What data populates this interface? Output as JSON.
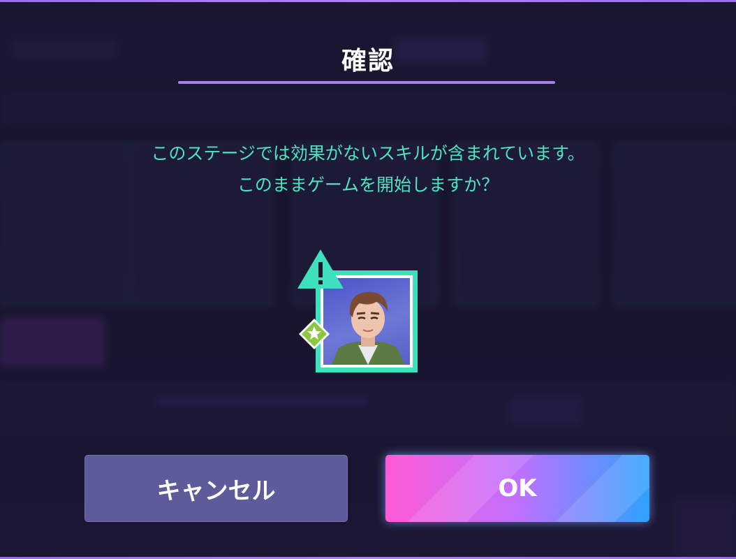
{
  "dialog": {
    "title": "確認",
    "message_line1": "このステージでは効果がないスキルが含まれています。",
    "message_line2": "このままゲームを開始しますか？"
  },
  "character_card": {
    "warning_icon": "warning-triangle-icon",
    "attribute_icon": "green-star-attribute-icon"
  },
  "buttons": {
    "cancel_label": "キャンセル",
    "ok_label": "OK"
  },
  "colors": {
    "accent_teal": "#4fe3c0",
    "title_underline": "#a97ff0",
    "cancel_bg": "#5d5b99",
    "ok_gradient_start": "#ff5ad6",
    "ok_gradient_end": "#2ea2ff"
  }
}
